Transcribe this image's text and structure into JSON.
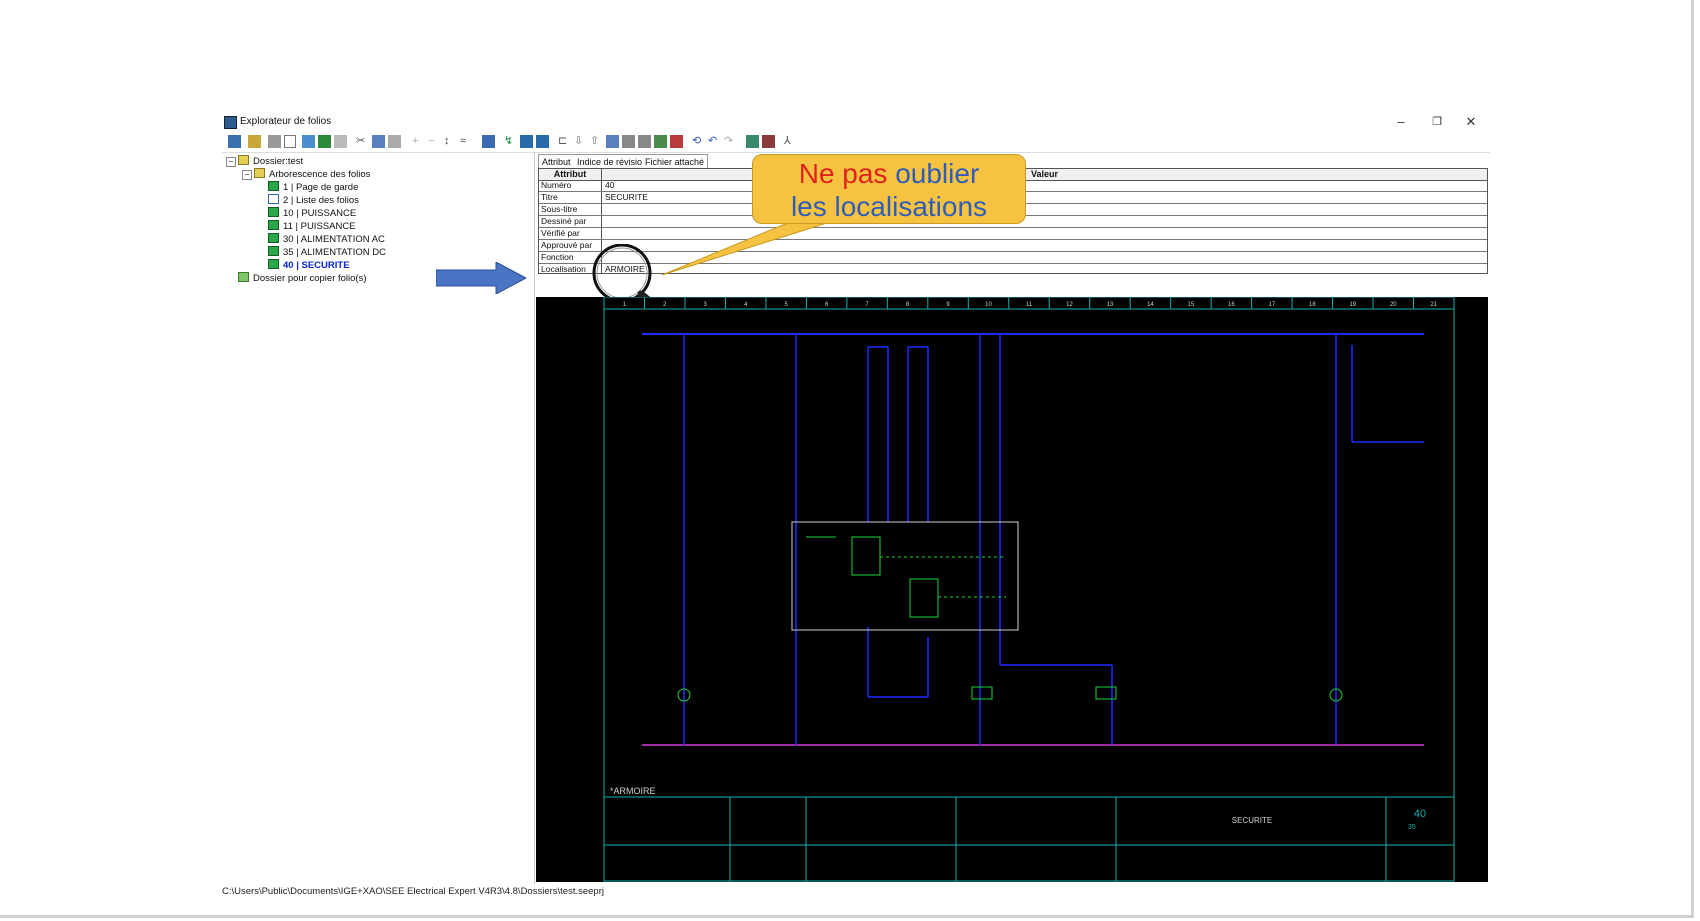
{
  "window": {
    "title": "Explorateur de folios",
    "minimize": "–",
    "maximize": "❐",
    "close": "✕"
  },
  "tree": {
    "root": "Dossier:test",
    "branch": "Arborescence des folios",
    "items": [
      {
        "label": "1 | Page de garde",
        "icon": "page-icon"
      },
      {
        "label": "2 | Liste des folios",
        "icon": "list-page-icon"
      },
      {
        "label": "10 | PUISSANCE",
        "icon": "page-icon"
      },
      {
        "label": "11 | PUISSANCE",
        "icon": "page-icon"
      },
      {
        "label": "30 | ALIMENTATION AC",
        "icon": "page-icon"
      },
      {
        "label": "35 | ALIMENTATION DC",
        "icon": "page-icon"
      },
      {
        "label": "40 | SECURITE",
        "icon": "page-icon",
        "selected": true
      }
    ],
    "copy_folder": "Dossier pour copier folio(s)"
  },
  "tabs": [
    "Attribut",
    "Indice de révision",
    "Fichier attaché"
  ],
  "grid": {
    "header_attr": "Attribut",
    "header_value": "Valeur",
    "rows": [
      {
        "attr": "Numéro",
        "value": "40"
      },
      {
        "attr": "Titre",
        "value": "SECURITE"
      },
      {
        "attr": "Sous-titre",
        "value": ""
      },
      {
        "attr": "Dessiné par",
        "value": ""
      },
      {
        "attr": "Vérifié par",
        "value": ""
      },
      {
        "attr": "Approuvé par",
        "value": ""
      },
      {
        "attr": "Fonction",
        "value": ""
      },
      {
        "attr": "Localisation",
        "value": "ARMOIRE"
      }
    ]
  },
  "callout": {
    "line1_red": "Ne pas ",
    "line1_blue": "oublier",
    "line2": "les localisations"
  },
  "schematic": {
    "columns": [
      "1",
      "2",
      "3",
      "4",
      "5",
      "6",
      "7",
      "8",
      "9",
      "10",
      "11",
      "12",
      "13",
      "14",
      "15",
      "16",
      "17",
      "18",
      "19",
      "20",
      "21"
    ],
    "location_label": "*ARMOIRE",
    "title_block_title": "SECURITE",
    "folio_number": "40",
    "next_folio": "35"
  },
  "status_bar": {
    "path": "C:\\Users\\Public\\Documents\\IGE+XAO\\SEE Electrical Expert V4R3\\4.8\\Dossiers\\test.seeprj"
  },
  "colors": {
    "callout_bg": "#f6c242",
    "callout_red": "#e0231b",
    "callout_blue": "#2f5db8",
    "arrow": "#4a74c4",
    "schematic_bg": "#000000",
    "wire_blue": "#1a2bff",
    "wire_cyan": "#14b0b0",
    "wire_magenta": "#d43ad4",
    "label_green": "#1bd23a",
    "label_red": "#e02020"
  }
}
